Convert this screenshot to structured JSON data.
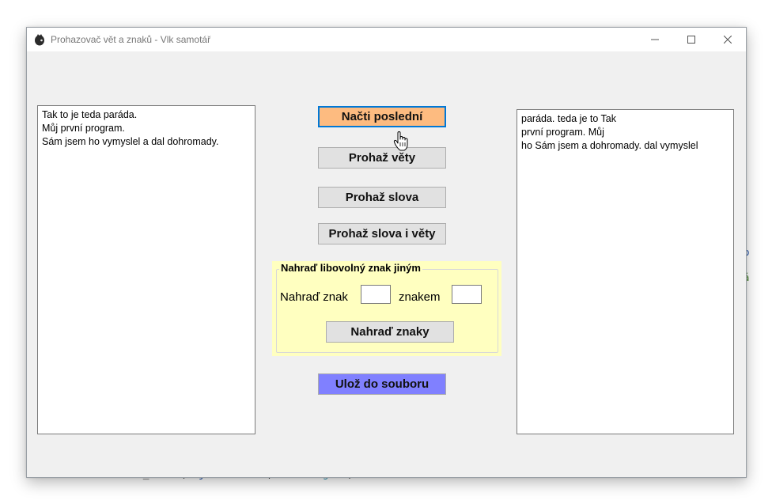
{
  "window": {
    "title": "Prohazovač vět a znaků - Vlk samotář",
    "minimize_icon": "minimize-icon",
    "maximize_icon": "maximize-icon",
    "close_icon": "close-icon"
  },
  "left_textbox": {
    "lines": [
      "Tak to je teda paráda.",
      "Můj první program.",
      "Sám jsem ho vymyslel a dal dohromady."
    ]
  },
  "right_textbox": {
    "lines": [
      "paráda. teda je to Tak",
      "první program. Můj",
      "ho Sám jsem a dohromady. dal vymyslel"
    ]
  },
  "buttons": {
    "load_last": "Načti poslední",
    "shuffle_sentences": "Prohaž věty",
    "shuffle_words": "Prohaž slova",
    "shuffle_words_and_sentences": "Prohaž slova i věty",
    "save_to_file": "Ulož do souboru"
  },
  "replace_group": {
    "legend": "Nahraď libovolný znak jiným",
    "replace_char_label": "Nahraď znak",
    "with_char_label": "znakem",
    "replace_char_value": "",
    "with_char_value": "",
    "replace_button": "Nahraď znaky"
  },
  "colors": {
    "load_button_bg": "#fdbb80",
    "load_button_border": "#0078d7",
    "save_button_bg": "#8080ff",
    "group_bg": "#ffffc0"
  }
}
